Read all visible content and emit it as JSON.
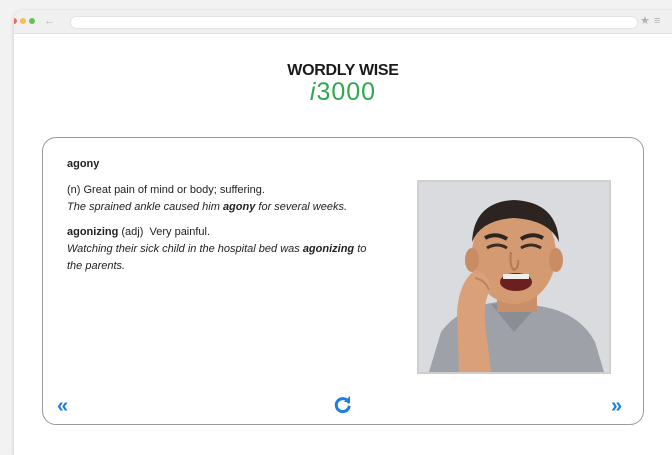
{
  "browser": {
    "back_icon": "back-arrow-icon",
    "star_icon": "star-icon",
    "menu_icon": "menu-icon"
  },
  "logo": {
    "line1": "WORDLY WISE",
    "line2_prefix": "i",
    "line2_number": "3000",
    "accent_color": "#2fa84f"
  },
  "card": {
    "word": "agony",
    "definition": "(n) Great pain of mind or body; suffering.",
    "example_before": "The sprained ankle caused him ",
    "example_bold": "agony",
    "example_after": " for several weeks.",
    "derived_word": "agonizing",
    "derived_pos": " (adj)",
    "derived_definition": "  Very painful.",
    "derived_example_before": "Watching their sick child in the hospital bed was ",
    "derived_example_bold": "agonizing",
    "derived_example_after": " to the parents."
  },
  "navigation": {
    "prev_label": "«",
    "next_label": "»",
    "reload_label": "↻",
    "accent_color": "#1a7fe0"
  }
}
